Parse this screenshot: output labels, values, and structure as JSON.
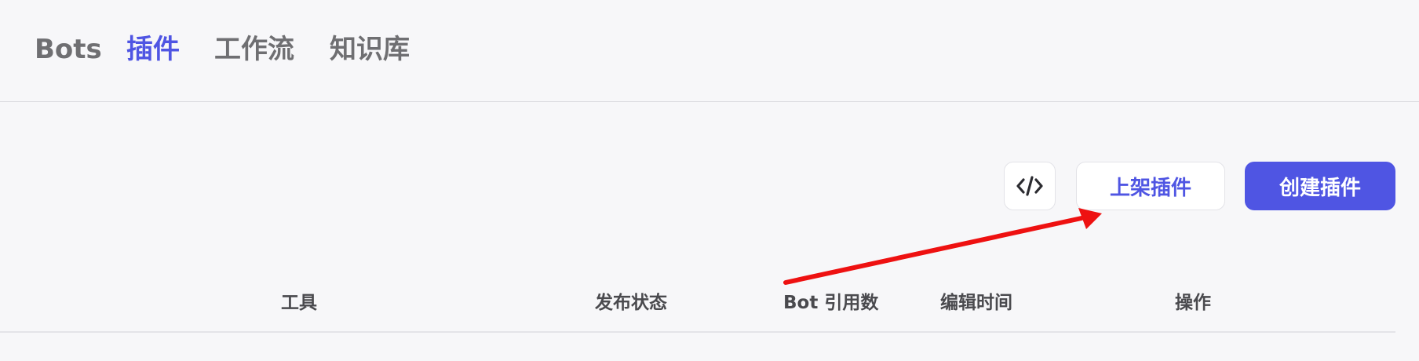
{
  "nav": {
    "tabs": [
      {
        "label": "Bots"
      },
      {
        "label": "插件"
      },
      {
        "label": "工作流"
      },
      {
        "label": "知识库"
      }
    ]
  },
  "toolbar": {
    "code_icon": "code-icon",
    "publish_label": "上架插件",
    "create_label": "创建插件"
  },
  "table": {
    "columns": [
      "工具",
      "发布状态",
      "Bot 引用数",
      "编辑时间",
      "操作"
    ]
  },
  "annotation": {
    "arrow_color": "#ee1111"
  },
  "colors": {
    "accent": "#4f55e3",
    "background": "#f7f7f9"
  }
}
